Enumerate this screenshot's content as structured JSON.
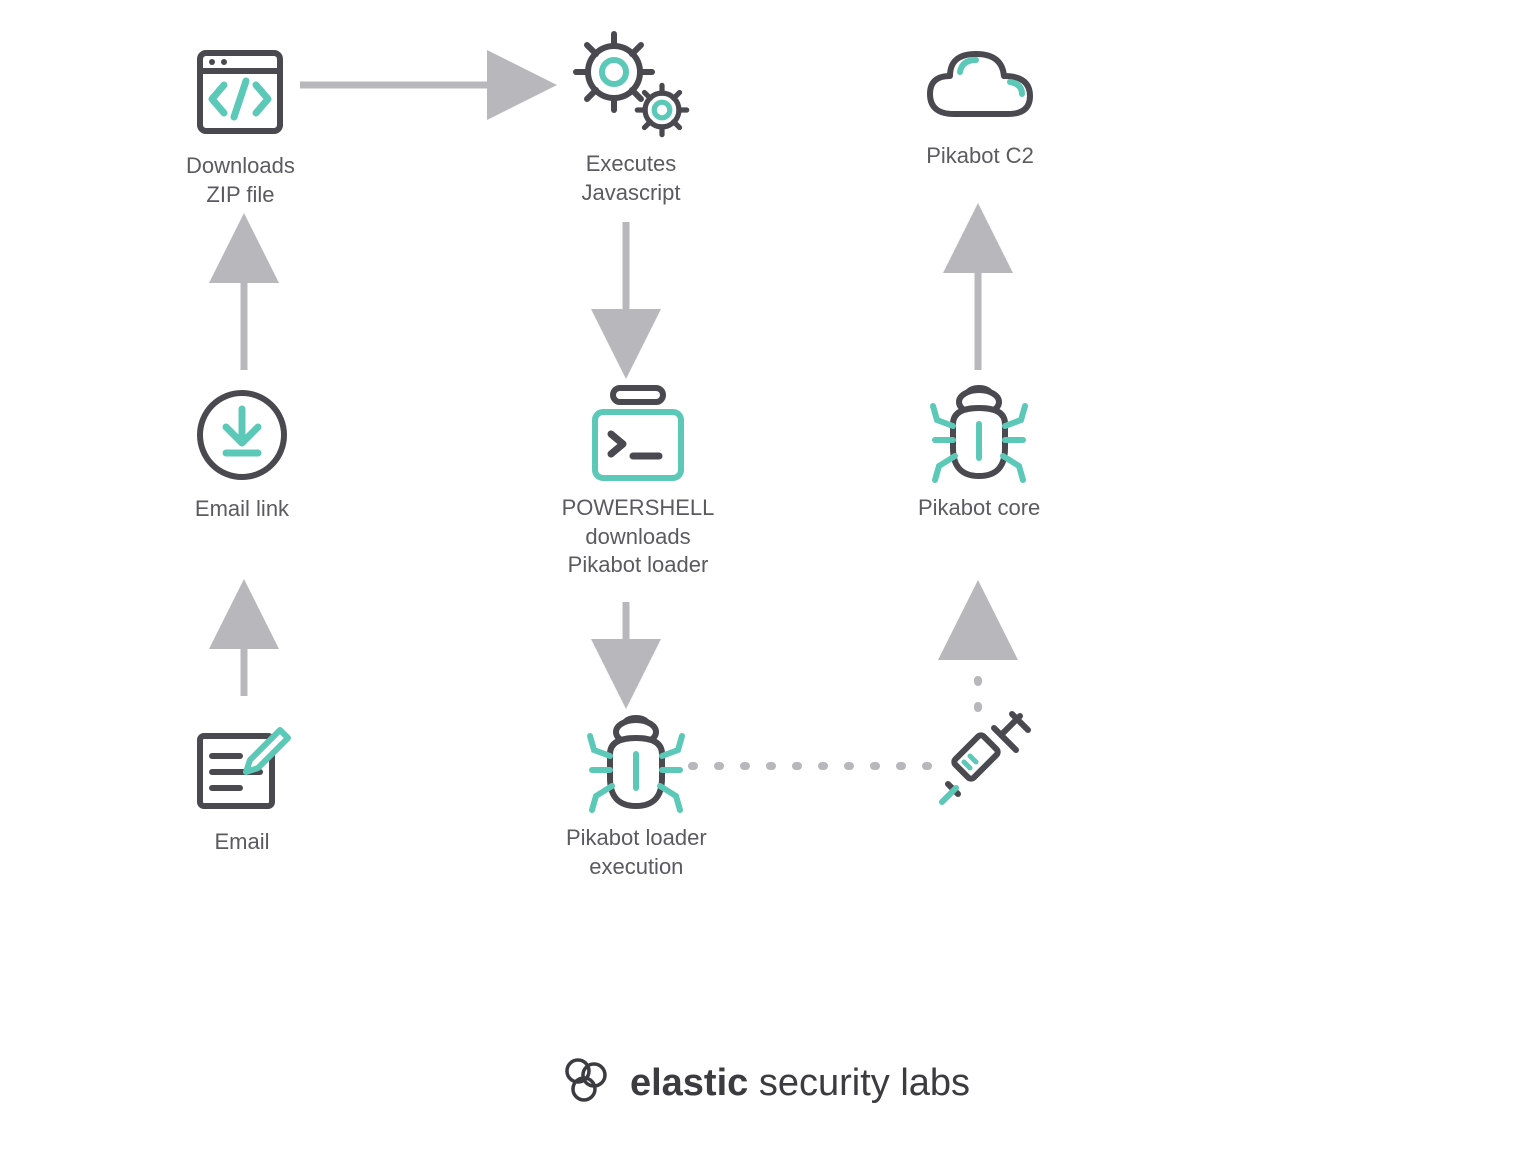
{
  "colors": {
    "stroke": "#49494f",
    "accent": "#5cc9b8",
    "arrow": "#b8b8bc",
    "text": "#5a5a60"
  },
  "nodes": {
    "email": {
      "label": "Email"
    },
    "email_link": {
      "label": "Email link"
    },
    "downloads_zip": {
      "label": "Downloads\nZIP file"
    },
    "executes_js": {
      "label": "Executes\nJavascript"
    },
    "powershell": {
      "label": "POWERSHELL\ndownloads\nPikabot loader"
    },
    "pikabot_loader": {
      "label": "Pikabot loader\nexecution"
    },
    "pikabot_core": {
      "label": "Pikabot core"
    },
    "pikabot_c2": {
      "label": "Pikabot C2"
    },
    "syringe": {
      "label": ""
    }
  },
  "footer": {
    "brand_bold": "elastic",
    "brand_rest": " security labs"
  }
}
